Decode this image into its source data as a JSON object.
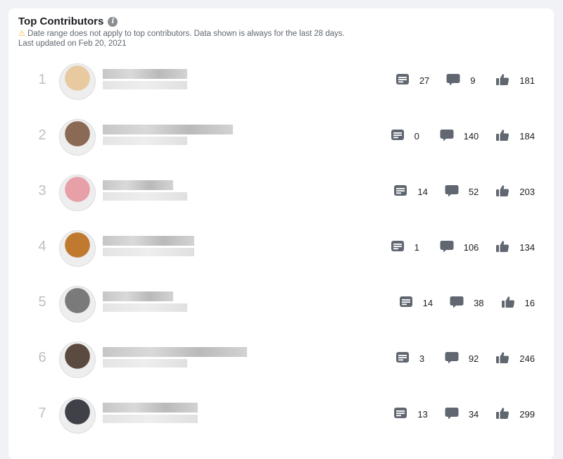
{
  "header": {
    "title": "Top Contributors",
    "info_icon": "info-icon",
    "warning_icon": "warning-icon",
    "note": "Date range does not apply to top contributors. Data shown is always for the last 28 days.",
    "updated": "Last updated on Feb 20, 2021"
  },
  "colors": {
    "icon": "#606770",
    "rank": "#bcc0c4",
    "warning": "#f7b928"
  },
  "contributors": [
    {
      "rank": "1",
      "posts": "27",
      "comments": "9",
      "reactions": "181",
      "avatar": "#e8c9a0"
    },
    {
      "rank": "2",
      "posts": "0",
      "comments": "140",
      "reactions": "184",
      "avatar": "#8a6a55"
    },
    {
      "rank": "3",
      "posts": "14",
      "comments": "52",
      "reactions": "203",
      "avatar": "#e8a0a8"
    },
    {
      "rank": "4",
      "posts": "1",
      "comments": "106",
      "reactions": "134",
      "avatar": "#c07a30"
    },
    {
      "rank": "5",
      "posts": "14",
      "comments": "38",
      "reactions": "16",
      "avatar": "#7a7a7a"
    },
    {
      "rank": "6",
      "posts": "3",
      "comments": "92",
      "reactions": "246",
      "avatar": "#5a4a40"
    },
    {
      "rank": "7",
      "posts": "13",
      "comments": "34",
      "reactions": "299",
      "avatar": "#404048"
    }
  ]
}
